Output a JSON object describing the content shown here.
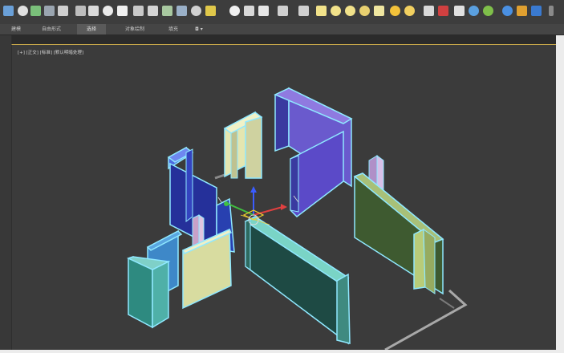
{
  "tabs": [
    {
      "label": "建模"
    },
    {
      "label": "自由形式"
    },
    {
      "label": "选择"
    },
    {
      "label": "对象绘制"
    },
    {
      "label": "填充"
    },
    {
      "label": "◘ ▾"
    }
  ],
  "viewport": {
    "label": "[+] [正交] [标准] [默认明暗处理]"
  },
  "colors": {
    "app_bg": "#2b2b2b",
    "viewport_bg": "#3b3b3b",
    "active_border": "#c9a94a",
    "selection_outline": "#7fe9e0"
  }
}
